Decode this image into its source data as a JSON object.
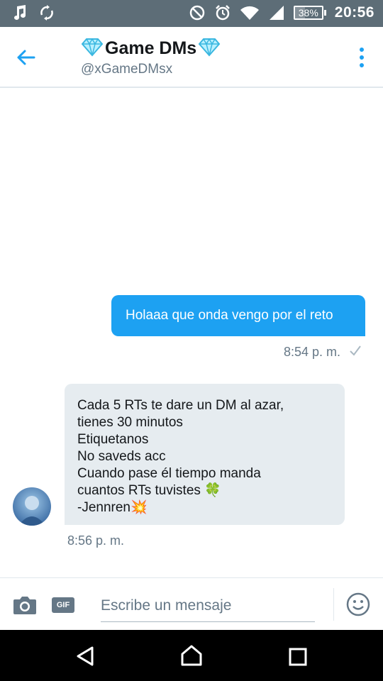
{
  "status_bar": {
    "time": "20:56",
    "battery_percent": "38%",
    "battery_level": 0.38,
    "icons": [
      "music-note-icon",
      "sync-icon",
      "do-not-disturb-icon",
      "alarm-icon",
      "wifi-icon",
      "cell-signal-icon",
      "battery-icon"
    ]
  },
  "header": {
    "title": "Game DMs",
    "handle": "@xGameDMsx",
    "title_emoji_icon": "diamond-icon",
    "back_icon": "back-arrow-icon",
    "more_icon": "more-vertical-icon"
  },
  "conversation": {
    "messages": [
      {
        "direction": "outgoing",
        "text": "Holaaa que onda vengo por el reto",
        "time": "8:54 p. m.",
        "status_icon": "check-icon"
      },
      {
        "direction": "incoming",
        "lines": [
          "Cada 5 RTs te dare un DM al azar,",
          "tienes 30 minutos",
          "Etiquetanos",
          "No saveds acc",
          "Cuando pase él tiempo manda",
          "cuantos RTs tuvistes 🍀",
          "-Jennren💥"
        ],
        "time": "8:56 p. m."
      }
    ]
  },
  "composer": {
    "placeholder": "Escribe un mensaje",
    "gif_label": "GIF",
    "camera_icon": "camera-icon",
    "emoji_icon": "emoji-icon"
  },
  "nav_bar": {
    "icons": [
      "nav-back-icon",
      "nav-home-icon",
      "nav-recents-icon"
    ]
  },
  "colors": {
    "accent": "#1da1f2",
    "status_bar": "#5d6d77",
    "incoming_bubble": "#e6ecf0",
    "secondary_text": "#657786"
  }
}
